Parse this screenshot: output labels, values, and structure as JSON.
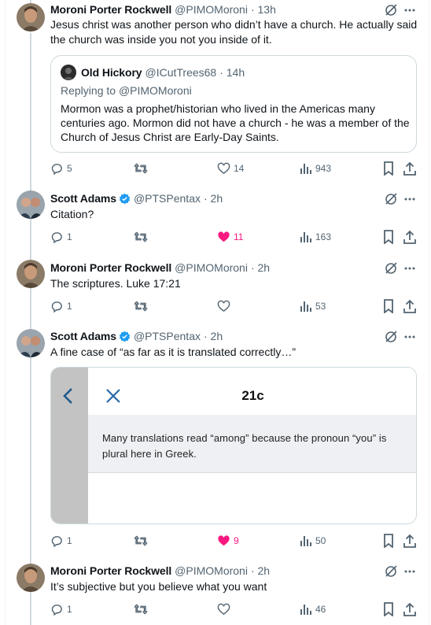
{
  "tweets": [
    {
      "name": "Moroni Porter Rockwell",
      "handle": "@PIMOMoroni",
      "time": "· 13h",
      "text": "Jesus christ was another person who didn’t have a church. He actually said the church was inside you not you inside of it.",
      "quote": {
        "name": "Old Hickory",
        "handle": "@ICutTrees68",
        "time": "· 14h",
        "replying_prefix": "Replying to ",
        "replying_to": "@PIMOMoroni",
        "text": "Mormon was a prophet/historian who lived in the Americas many centuries ago. Mormon did not have a church - he was a member of the Church of Jesus Christ are Early-Day Saints."
      },
      "replies": "5",
      "retweets": "",
      "likes": "14",
      "views": "943",
      "liked": false
    },
    {
      "name": "Scott Adams",
      "handle": "@PTSPentax",
      "time": "· 2h",
      "verified": true,
      "text": "Citation?",
      "replies": "1",
      "retweets": "",
      "likes": "11",
      "views": "163",
      "liked": true
    },
    {
      "name": "Moroni Porter Rockwell",
      "handle": "@PIMOMoroni",
      "time": "· 2h",
      "text": "The scriptures. Luke 17:21",
      "replies": "1",
      "retweets": "",
      "likes": "",
      "views": "53",
      "liked": false
    },
    {
      "name": "Scott Adams",
      "handle": "@PTSPentax",
      "time": "· 2h",
      "verified": true,
      "text": "A fine case of “as far as it is translated correctly…”",
      "media": {
        "title": "21c",
        "note": "Many translations read “among” because the pronoun “you” is plural here in Greek."
      },
      "replies": "1",
      "retweets": "",
      "likes": "9",
      "views": "50",
      "liked": true
    },
    {
      "name": "Moroni Porter Rockwell",
      "handle": "@PIMOMoroni",
      "time": "· 2h",
      "text": "It’s subjective but you believe what you want",
      "replies": "1",
      "retweets": "",
      "likes": "",
      "views": "46",
      "liked": false
    }
  ],
  "colors": {
    "like_active": "#f91880",
    "verified": "#1d9bf0",
    "secondary_text": "#536471",
    "thread_line": "#cfd9de"
  },
  "icons": {
    "reply": "reply-icon",
    "retweet": "retweet-icon",
    "like": "heart-icon",
    "views": "views-chart-icon",
    "bookmark": "bookmark-icon",
    "share": "share-icon",
    "grok": "grok-icon",
    "more": "more-icon"
  }
}
